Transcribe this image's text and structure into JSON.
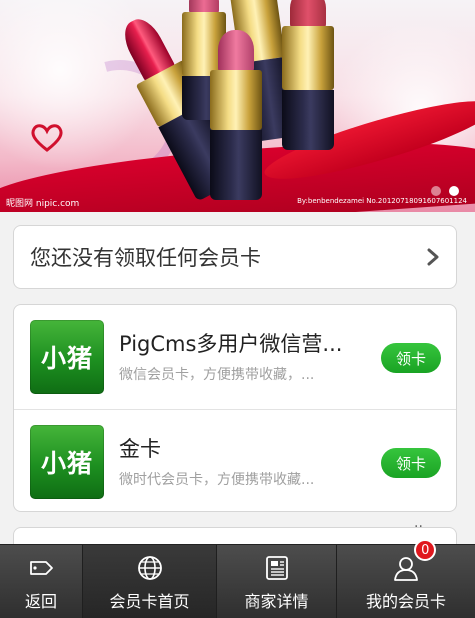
{
  "banner": {
    "watermark_left": "昵图网 nipic.com",
    "watermark_right": "By:benbendezamei  No.20120718091607601124",
    "slide_count": 2,
    "active_slide": 2
  },
  "notice": {
    "text": "您还没有领取任何会员卡"
  },
  "cards": [
    {
      "logo_text": "小猪",
      "title": "PigCms多用户微信营...",
      "desc": "微信会员卡，方便携带收藏，...",
      "button": "领卡"
    },
    {
      "logo_text": "小猪",
      "title": "金卡",
      "desc": "微时代会员卡，方便携带收藏...",
      "button": "领卡"
    }
  ],
  "more_indicator": "..",
  "nav": {
    "items": [
      {
        "label": "返回",
        "icon": "tag-icon"
      },
      {
        "label": "会员卡首页",
        "icon": "globe-icon"
      },
      {
        "label": "商家详情",
        "icon": "document-icon"
      },
      {
        "label": "我的会员卡",
        "icon": "user-icon",
        "badge": "0"
      }
    ],
    "active_index": 1
  },
  "colors": {
    "accent_green": "#1aa324",
    "nav_background": "#3a3a3a",
    "badge_red": "#e0181e"
  }
}
